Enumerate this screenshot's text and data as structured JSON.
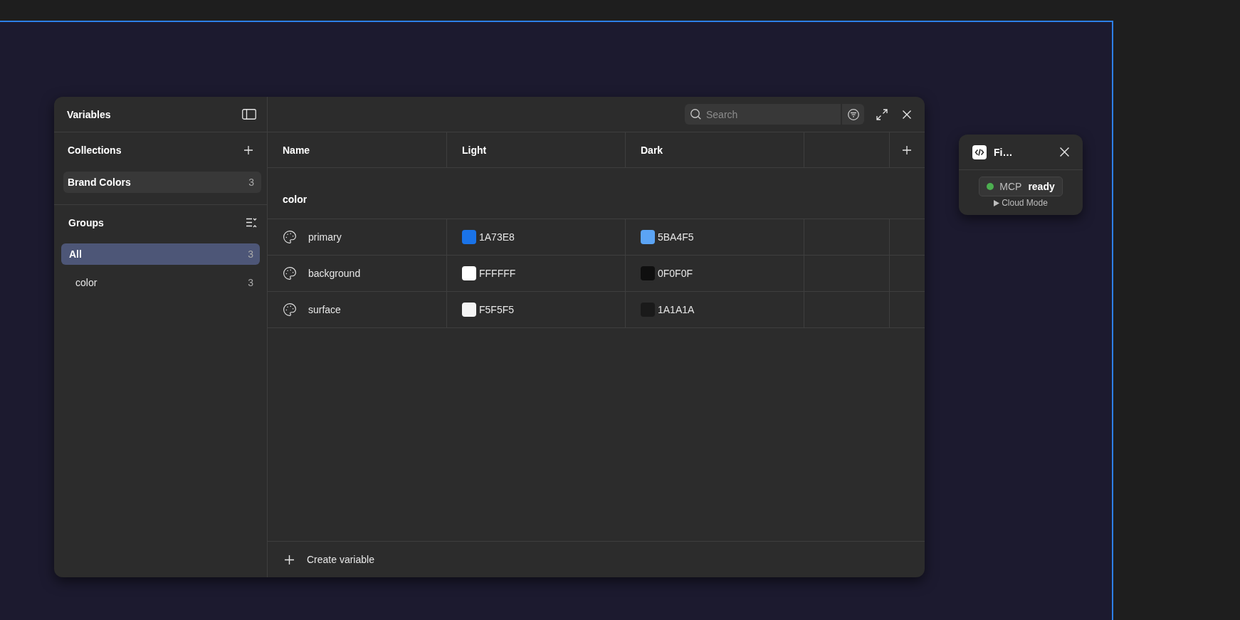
{
  "variables_panel": {
    "title": "Variables",
    "collections": {
      "title": "Collections",
      "items": [
        {
          "label": "Brand Colors",
          "count": "3",
          "selected": true
        }
      ]
    },
    "groups": {
      "title": "Groups",
      "items": [
        {
          "label": "All",
          "count": "3",
          "selected": true,
          "children": [
            {
              "label": "color",
              "count": "3",
              "selected": false
            }
          ]
        }
      ]
    }
  },
  "toolbar": {
    "search": {
      "placeholder": "Search"
    }
  },
  "table": {
    "columns": [
      {
        "label": "Name"
      },
      {
        "label": "Light"
      },
      {
        "label": "Dark"
      }
    ],
    "groups": [
      {
        "name": "color",
        "rows": [
          {
            "name": "primary",
            "values": [
              {
                "value": "1A73E8",
                "color": "#1a73e8"
              },
              {
                "value": "5BA4F5",
                "color": "#5ba4f5"
              }
            ]
          },
          {
            "name": "background",
            "values": [
              {
                "value": "FFFFFF",
                "color": "#ffffff"
              },
              {
                "value": "0F0F0F",
                "color": "#0f0f0f"
              }
            ]
          },
          {
            "name": "surface",
            "values": [
              {
                "value": "F5F5F5",
                "color": "#f5f5f5"
              },
              {
                "value": "1A1A1A",
                "color": "#1a1a1a"
              }
            ]
          }
        ]
      }
    ],
    "footer": {
      "create_label": "Create variable"
    }
  },
  "plugin_widget": {
    "title": "Fi…",
    "status": {
      "label": "MCP",
      "value": "ready",
      "color": "#4caf50"
    },
    "mode": {
      "label": "Cloud Mode",
      "expanded": false
    }
  }
}
